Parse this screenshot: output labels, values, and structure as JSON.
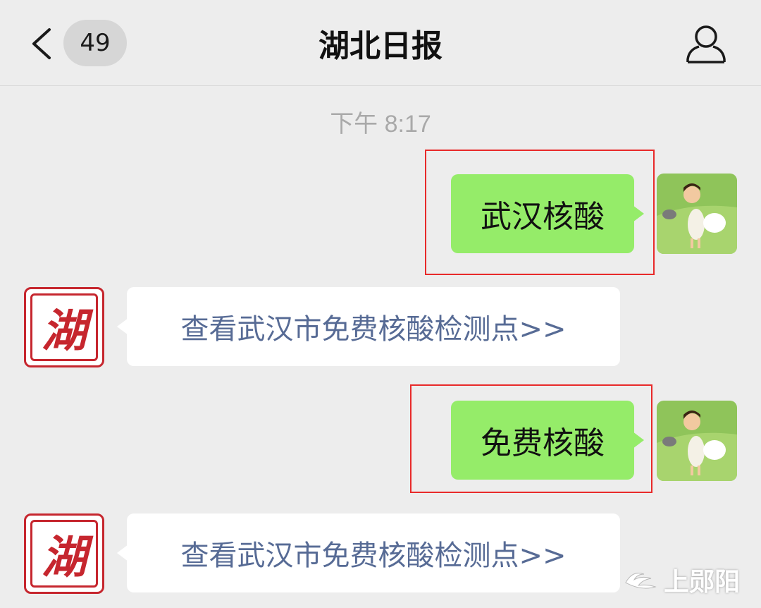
{
  "header": {
    "back_icon": "chevron-left-icon",
    "unread_count": "49",
    "title": "湖北日报",
    "profile_icon": "person-icon"
  },
  "timestamp": "下午 8:17",
  "messages": [
    {
      "from": "user",
      "text": "武汉核酸",
      "highlighted": true
    },
    {
      "from": "bot",
      "text": "查看武汉市免费核酸检测点>>",
      "link": true
    },
    {
      "from": "user",
      "text": "免费核酸",
      "highlighted": true
    },
    {
      "from": "bot",
      "text": "查看武汉市免费核酸检测点>>",
      "link": true
    }
  ],
  "bot_avatar_glyph": "湖",
  "watermark": "上郧阳",
  "colors": {
    "background": "#ededed",
    "sent_bubble": "#95ec69",
    "received_bubble": "#ffffff",
    "link_text": "#576b95",
    "highlight": "#e82a2a",
    "bot_avatar": "#c6262e"
  }
}
